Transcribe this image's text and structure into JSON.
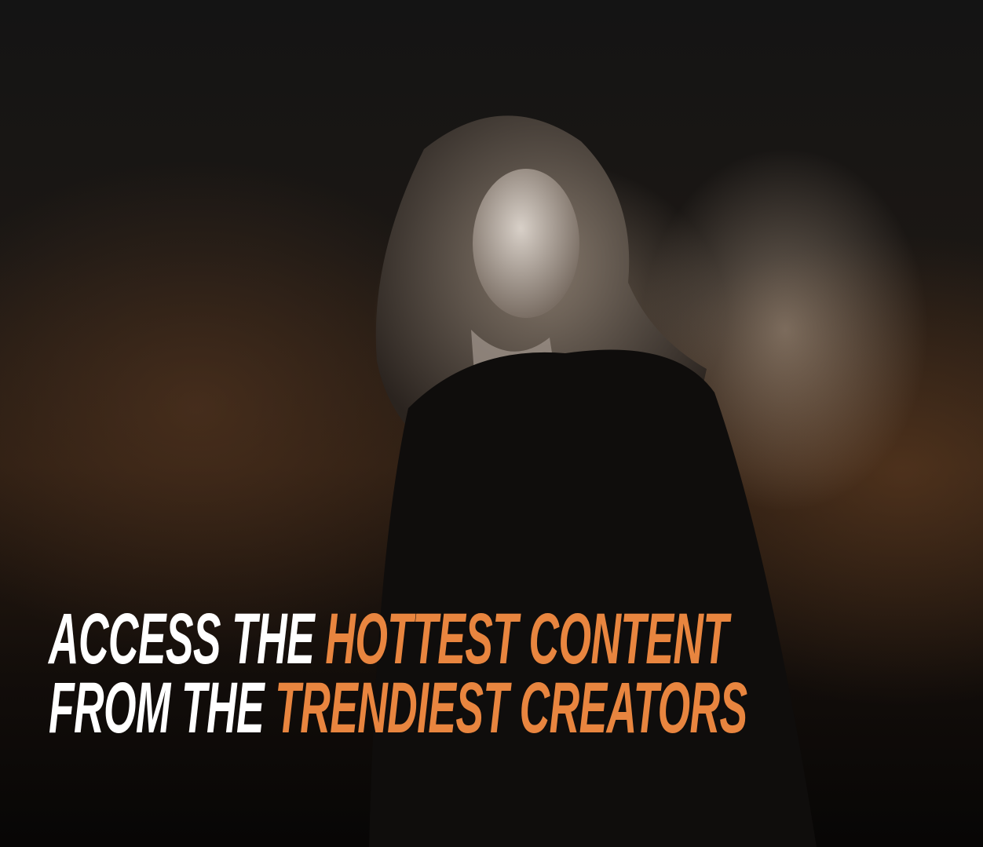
{
  "headline": {
    "line1_white": "ACCESS THE ",
    "line1_orange": "HOTTEST CONTENT",
    "line2_white": "FROM THE ",
    "line2_orange": "TRENDIEST CREATORS"
  },
  "colors": {
    "accent": "#e8853f",
    "text": "#ffffff",
    "background": "#0c0a09"
  }
}
